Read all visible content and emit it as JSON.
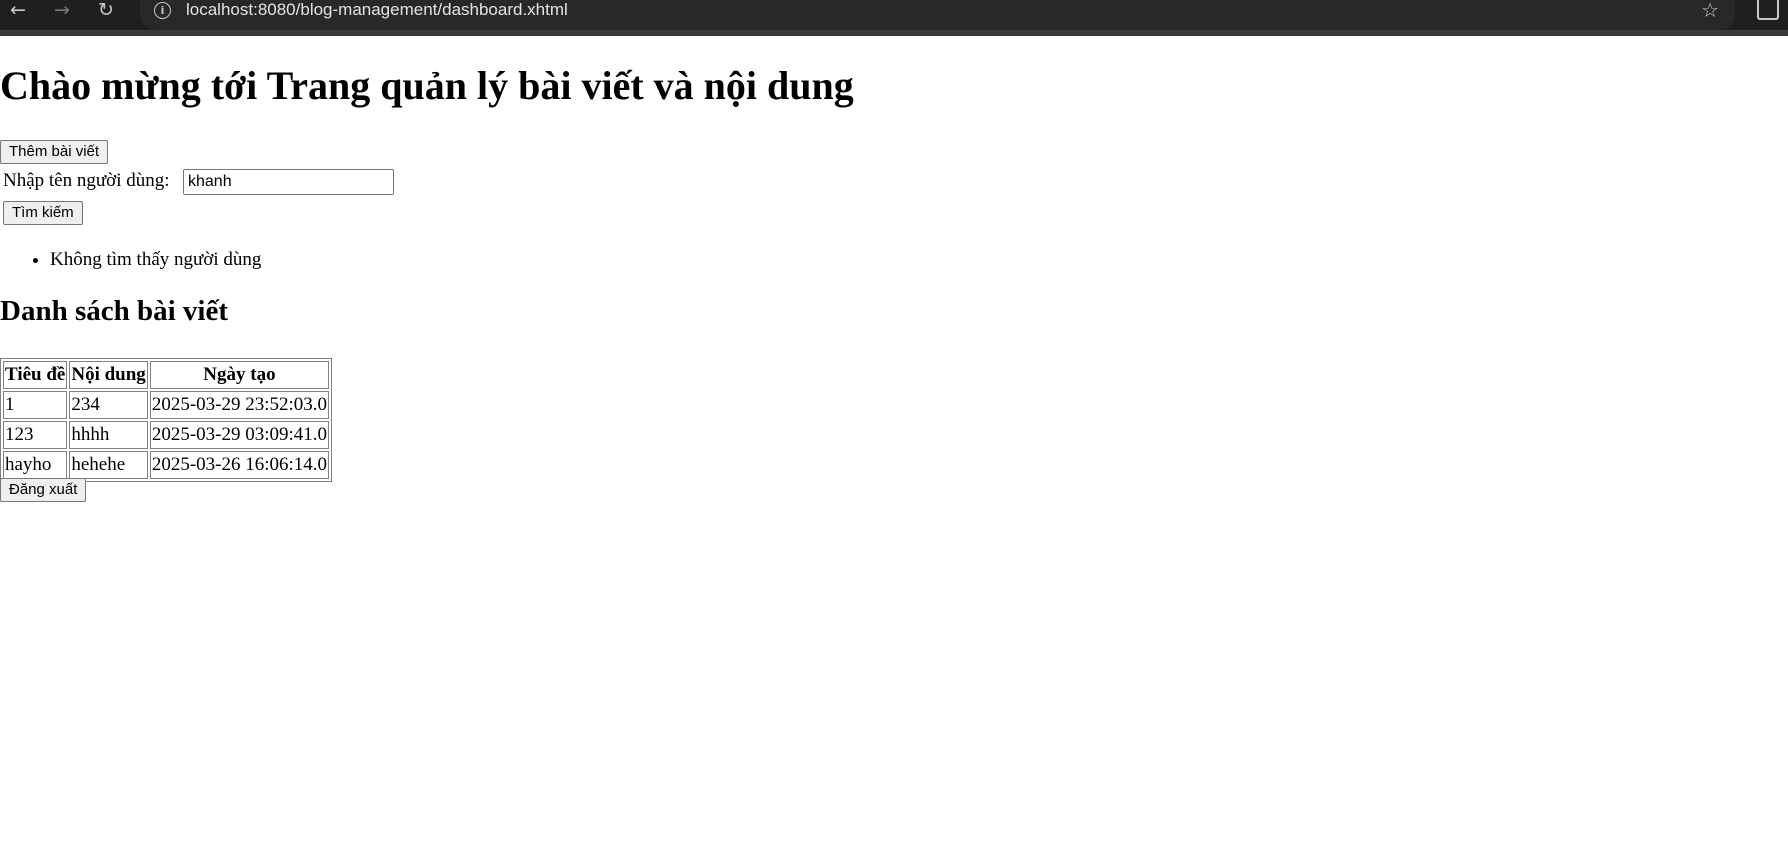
{
  "browser": {
    "url": "localhost:8080/blog-management/dashboard.xhtml",
    "back_icon": "back-arrow-icon",
    "forward_icon": "forward-arrow-icon",
    "reload_icon": "reload-icon",
    "info_icon": "info-icon",
    "bookmark_icon": "star-icon",
    "extensions_icon": "extensions-icon"
  },
  "page": {
    "heading": "Chào mừng tới Trang quản lý bài viết và nội dung",
    "add_post_label": "Thêm bài viết",
    "search": {
      "label": "Nhập tên người dùng:",
      "value": "khanh",
      "button_label": "Tìm kiếm"
    },
    "search_results": [
      "Không tìm thấy người dùng"
    ],
    "posts_heading": "Danh sách bài viết",
    "table": {
      "headers": [
        "Tiêu đề",
        "Nội dung",
        "Ngày tạo"
      ],
      "rows": [
        [
          "1",
          "234",
          "2025-03-29 23:52:03.0"
        ],
        [
          "123",
          "hhhh",
          "2025-03-29 03:09:41.0"
        ],
        [
          "hayho",
          "hehehe",
          "2025-03-26 16:06:14.0"
        ]
      ]
    },
    "logout_label": "Đăng xuất"
  }
}
